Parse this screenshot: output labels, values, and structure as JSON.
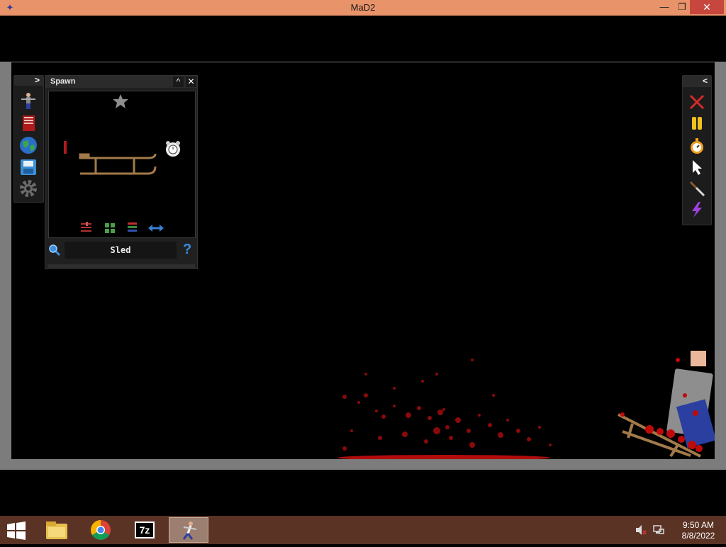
{
  "window": {
    "title": "MaD2",
    "minimize_glyph": "—",
    "maximize_glyph": "❐",
    "close_glyph": "✕"
  },
  "left_toolbar": {
    "collapse_glyph": ">",
    "items": [
      "figure-icon",
      "book-icon",
      "globe-icon",
      "save-icon",
      "gear-icon"
    ]
  },
  "spawn_panel": {
    "title": "Spawn",
    "collapse_glyph": "^",
    "close_glyph": "✕",
    "search_value": "Sled",
    "help_glyph": "?",
    "items": [
      "star-icon",
      "red-stick-item",
      "sled-item",
      "alarm-clock-item"
    ],
    "filter_icons": [
      "sliders-icon",
      "grid-icon",
      "list-icon",
      "swap-arrows-icon"
    ]
  },
  "right_toolbar": {
    "collapse_glyph": "<",
    "items": [
      "delete-x-icon",
      "pause-icon",
      "stopwatch-icon",
      "cursor-icon",
      "knife-icon",
      "lightning-icon"
    ]
  },
  "taskbar": {
    "apps": [
      "file-explorer-icon",
      "chrome-icon",
      "7zip-icon",
      "mad2-icon"
    ],
    "sevenzip_label": "7z",
    "time": "9:50 AM",
    "date": "8/8/2022"
  },
  "colors": {
    "title_bar": "#e9936a",
    "taskbar": "#5a3324",
    "frame": "#7c7c7c",
    "blood": "#b00c0c"
  }
}
